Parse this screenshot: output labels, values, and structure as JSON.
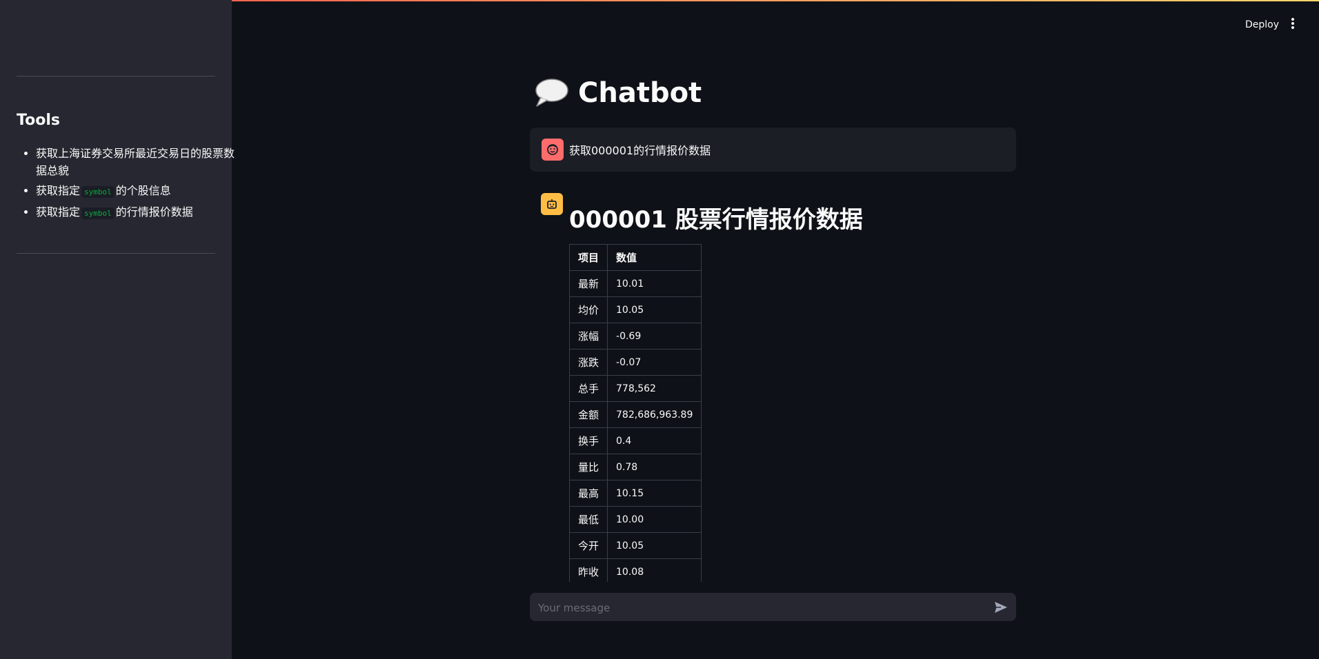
{
  "app": {
    "deploy_label": "Deploy"
  },
  "sidebar": {
    "title": "Tools",
    "items": [
      {
        "text": "获取上海证券交易所最近交易日的股票数据总貌"
      },
      {
        "pre": "获取指定",
        "code": "symbol",
        "post": "的个股信息"
      },
      {
        "pre": "获取指定",
        "code": "symbol",
        "post": "的行情报价数据"
      }
    ]
  },
  "main": {
    "title": "Chatbot",
    "title_icon": "speech-bubble-icon"
  },
  "messages": [
    {
      "role": "user",
      "avatar_icon": "user-face-icon",
      "text": "获取000001的行情报价数据"
    },
    {
      "role": "assistant",
      "avatar_icon": "robot-icon",
      "heading": "000001 股票行情报价数据"
    }
  ],
  "quote_table": {
    "headers": [
      "项目",
      "数值"
    ],
    "rows": [
      [
        "最新",
        "10.01"
      ],
      [
        "均价",
        "10.05"
      ],
      [
        "涨幅",
        "-0.69"
      ],
      [
        "涨跌",
        "-0.07"
      ],
      [
        "总手",
        "778,562"
      ],
      [
        "金额",
        "782,686,963.89"
      ],
      [
        "换手",
        "0.4"
      ],
      [
        "量比",
        "0.78"
      ],
      [
        "最高",
        "10.15"
      ],
      [
        "最低",
        "10.00"
      ],
      [
        "今开",
        "10.05"
      ],
      [
        "昨收",
        "10.08"
      ]
    ]
  },
  "chat_input": {
    "placeholder": "Your message",
    "value": ""
  },
  "colors": {
    "background": "#0e1117",
    "sidebar": "#262730",
    "user_avatar": "#ff6c6c",
    "bot_avatar": "#ffbd45",
    "code_text": "#09ab3b"
  }
}
